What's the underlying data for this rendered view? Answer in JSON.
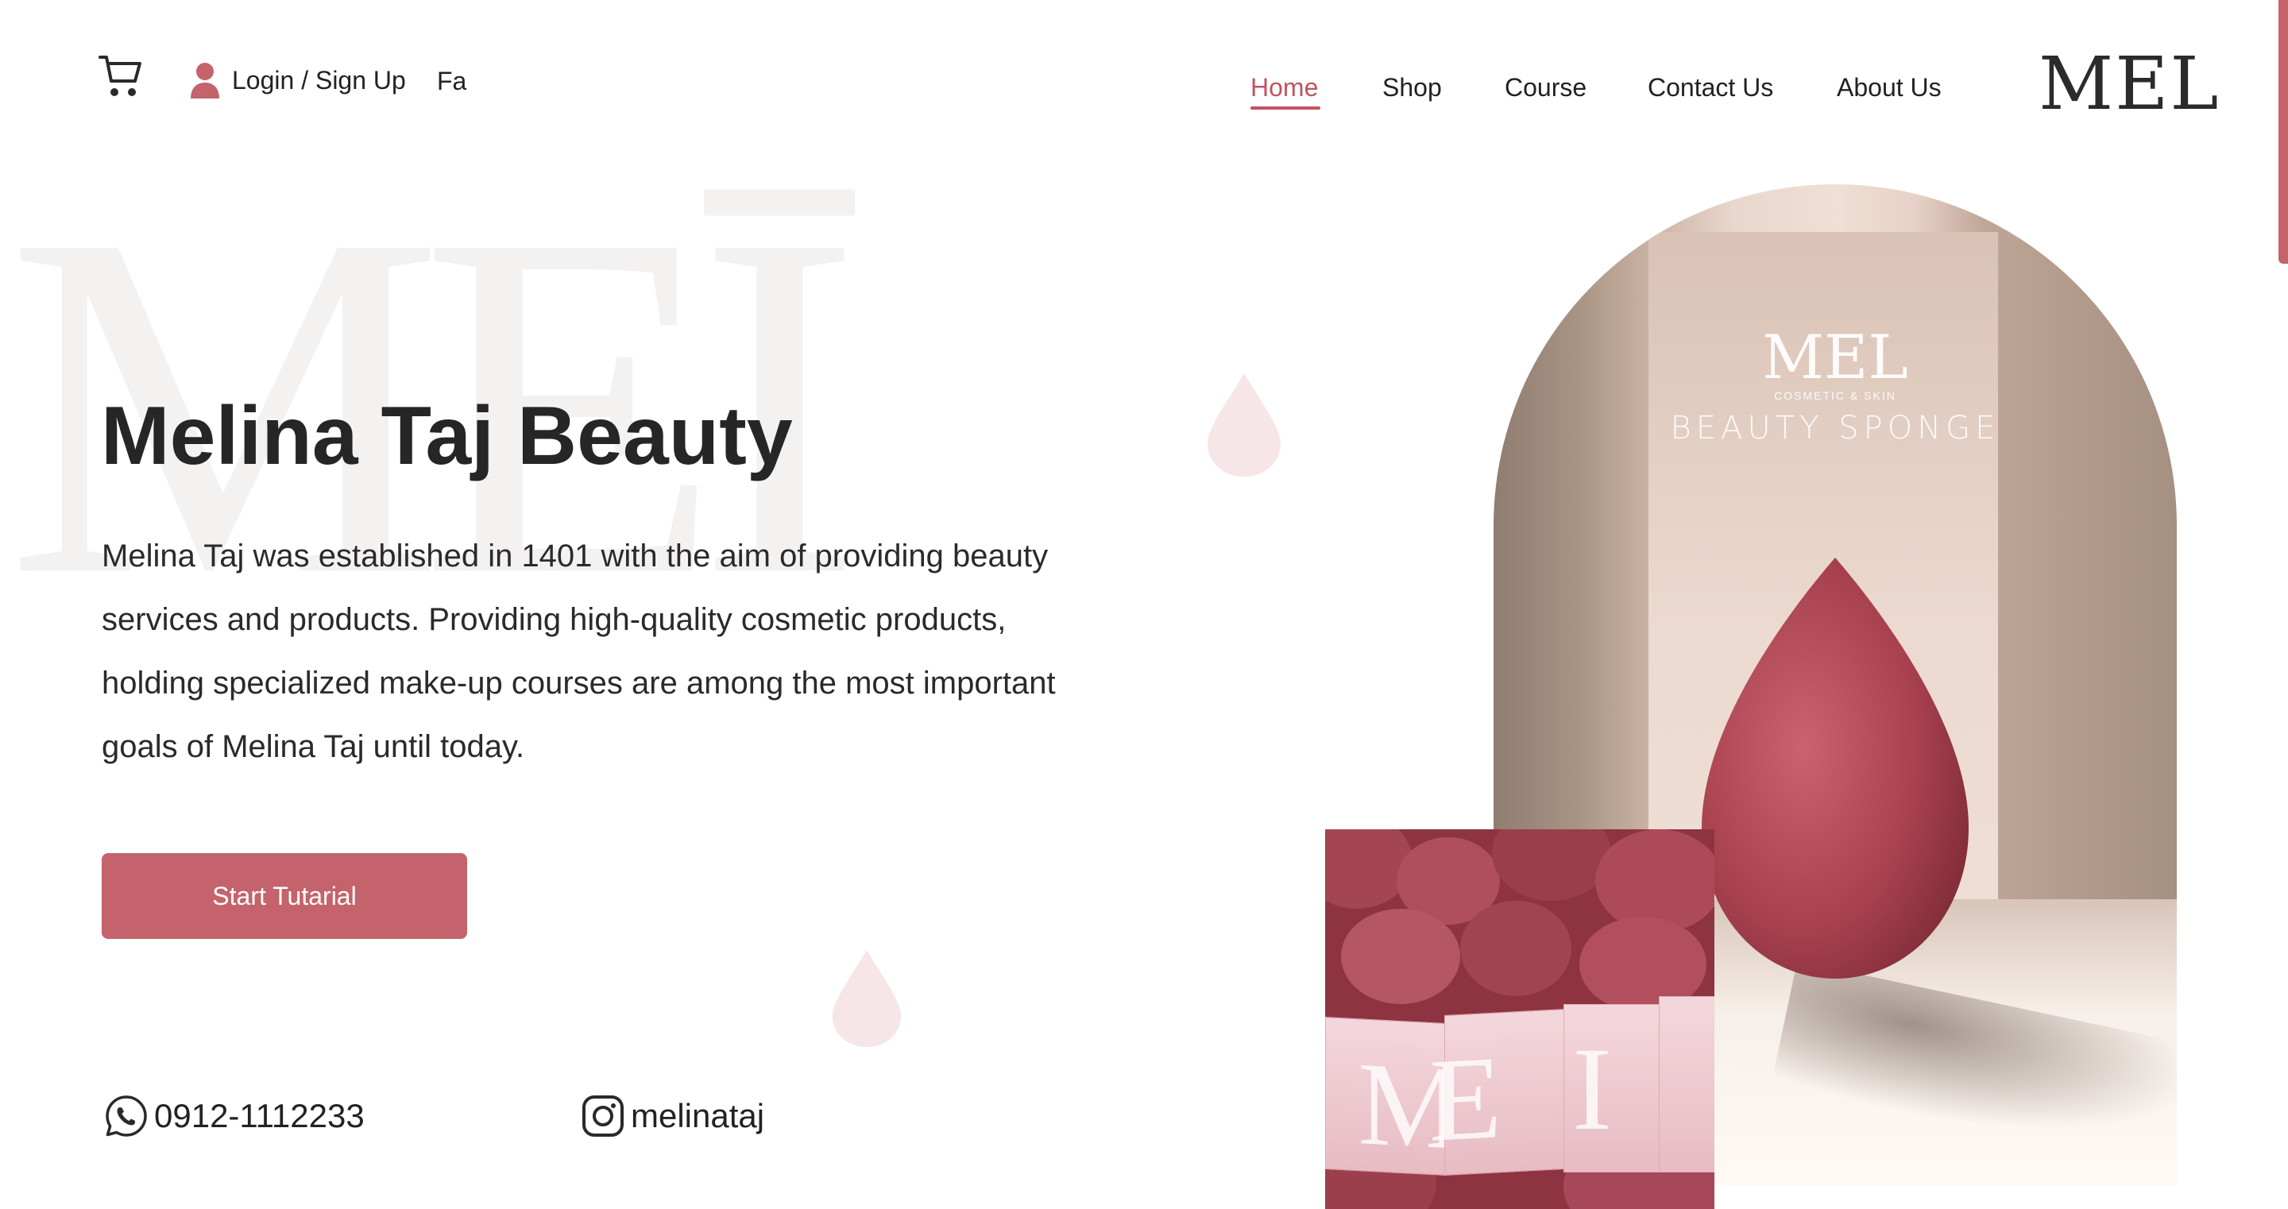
{
  "header": {
    "login_label": "Login / Sign Up",
    "lang_label": "Fa",
    "logo_text": "MEL"
  },
  "nav": {
    "items": [
      {
        "label": "Home",
        "active": true
      },
      {
        "label": "Shop",
        "active": false
      },
      {
        "label": "Course",
        "active": false
      },
      {
        "label": "Contact Us",
        "active": false
      },
      {
        "label": "About Us",
        "active": false
      }
    ]
  },
  "hero": {
    "title": "Melina Taj Beauty",
    "description": "Melina Taj was established in 1401 with the aim of providing beauty services and products. Providing high-quality cosmetic products, holding specialized make-up courses are among the most important goals of Melina Taj until today.",
    "cta_label": "Start Tutarial"
  },
  "contact": {
    "phone": "0912-1112233",
    "instagram": "melinataj"
  },
  "product_image": {
    "brand": "MEL",
    "brand_sub": "COSMETIC & SKIN",
    "product_name": "BEAUTY SPONGE"
  },
  "colors": {
    "accent": "#c4636c",
    "text": "#222222"
  }
}
